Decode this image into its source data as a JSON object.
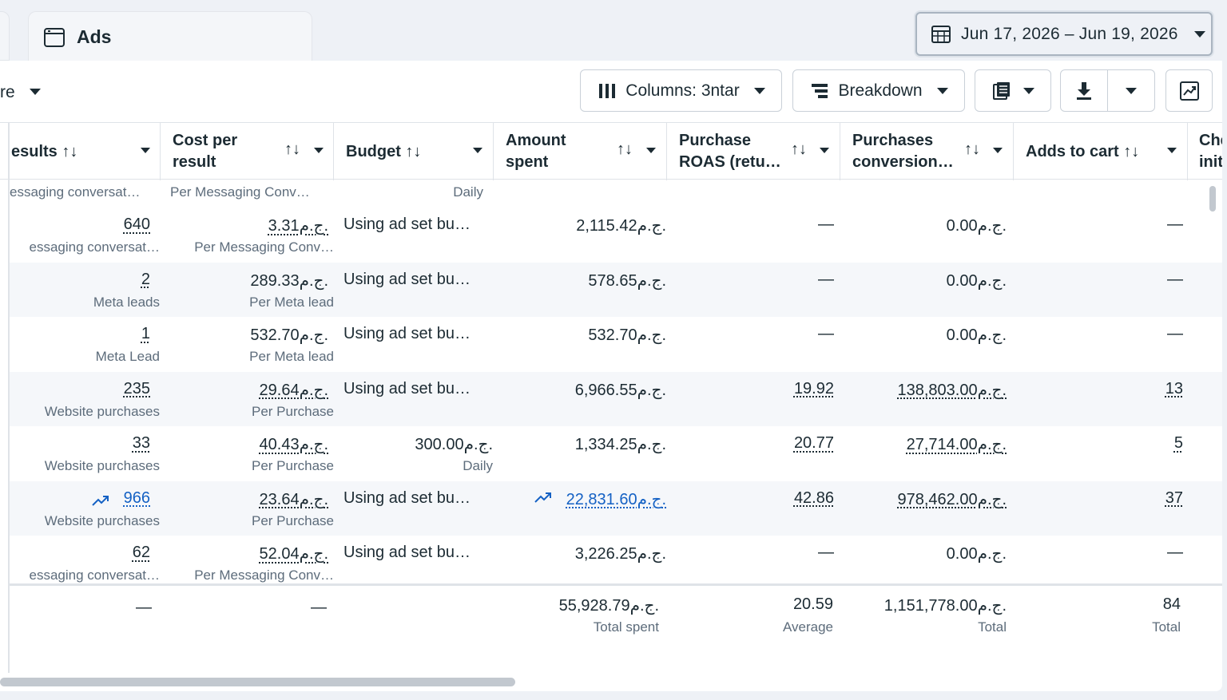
{
  "tab": {
    "label": "Ads",
    "icon": "ad-frame-icon"
  },
  "date_range": {
    "label": "Jun 17, 2026 – Jun 19, 2026",
    "icon": "calendar-icon"
  },
  "toolbar": {
    "left_text": "re",
    "columns_label": "Columns: 3ntar",
    "breakdown_label": "Breakdown"
  },
  "columns": [
    {
      "key": "results",
      "label": "esults ↑↓"
    },
    {
      "key": "cost",
      "label_line1": "Cost per",
      "label_line2": "result",
      "sort": "↑↓"
    },
    {
      "key": "budget",
      "label": "Budget ↑↓"
    },
    {
      "key": "amount",
      "label_line1": "Amount",
      "label_line2": "spent",
      "sort": "↑↓"
    },
    {
      "key": "roas",
      "label_line1": "Purchase",
      "label_line2": "ROAS (retu…",
      "sort": "↑↓"
    },
    {
      "key": "conv",
      "label_line1": "Purchases",
      "label_line2": "conversion…",
      "sort": "↑↓"
    },
    {
      "key": "cart",
      "label": "Adds to cart ↑↓"
    },
    {
      "key": "check",
      "label_line1": "Che",
      "label_line2": "init"
    }
  ],
  "partial_row": {
    "results_sub": "essaging conversat…",
    "cost_sub": "Per Messaging Conv…",
    "budget_sub": "Daily"
  },
  "rows": [
    {
      "results": "640",
      "results_sub": "essaging conversat…",
      "cost": "3.31ج.م.",
      "cost_sub": "Per Messaging Conv…",
      "budget": "Using ad set bu…",
      "budget_sub": "",
      "amount": "2,115.42ج.م.",
      "roas": "—",
      "conv": "0.00ج.م.",
      "cart": "—"
    },
    {
      "results": "2",
      "results_sub": "Meta leads",
      "cost": "289.33ج.م.",
      "cost_sub": "Per Meta lead",
      "budget": "Using ad set bu…",
      "budget_sub": "",
      "amount": "578.65ج.م.",
      "roas": "—",
      "conv": "0.00ج.م.",
      "cart": "—"
    },
    {
      "results": "1",
      "results_sub": "Meta Lead",
      "cost": "532.70ج.م.",
      "cost_sub": "Per Meta lead",
      "budget": "Using ad set bu…",
      "budget_sub": "",
      "amount": "532.70ج.م.",
      "roas": "—",
      "conv": "0.00ج.م.",
      "cart": "—"
    },
    {
      "results": "235",
      "results_sub": "Website purchases",
      "cost": "29.64ج.م.",
      "cost_sub": "Per Purchase",
      "budget": "Using ad set bu…",
      "budget_sub": "",
      "amount": "6,966.55ج.م.",
      "roas": "19.92",
      "conv": "138,803.00ج.م.",
      "cart": "13"
    },
    {
      "results": "33",
      "results_sub": "Website purchases",
      "cost": "40.43ج.م.",
      "cost_sub": "Per Purchase",
      "budget": "300.00ج.م.",
      "budget_sub": "Daily",
      "amount": "1,334.25ج.م.",
      "roas": "20.77",
      "conv": "27,714.00ج.م.",
      "cart": "5"
    },
    {
      "results": "966",
      "results_sub": "Website purchases",
      "cost": "23.64ج.م.",
      "cost_sub": "Per Purchase",
      "budget": "Using ad set bu…",
      "budget_sub": "",
      "amount": "22,831.60ج.م.",
      "roas": "42.86",
      "conv": "978,462.00ج.م.",
      "cart": "37"
    },
    {
      "results": "62",
      "results_sub": "essaging conversat…",
      "cost": "52.04ج.م.",
      "cost_sub": "Per Messaging Conv…",
      "budget": "Using ad set bu…",
      "budget_sub": "",
      "amount": "3,226.25ج.م.",
      "roas": "—",
      "conv": "0.00ج.م.",
      "cart": "—"
    }
  ],
  "totals": {
    "results": "—",
    "cost": "—",
    "amount": "55,928.79ج.م.",
    "amount_sub": "Total spent",
    "roas": "20.59",
    "roas_sub": "Average",
    "conv": "1,151,778.00ج.م.",
    "conv_sub": "Total",
    "cart": "84",
    "cart_sub": "Total"
  },
  "colors": {
    "link": "#1461c4",
    "text": "#1c2b33",
    "muted": "#5d6c7b",
    "border": "#dfe3e8"
  }
}
